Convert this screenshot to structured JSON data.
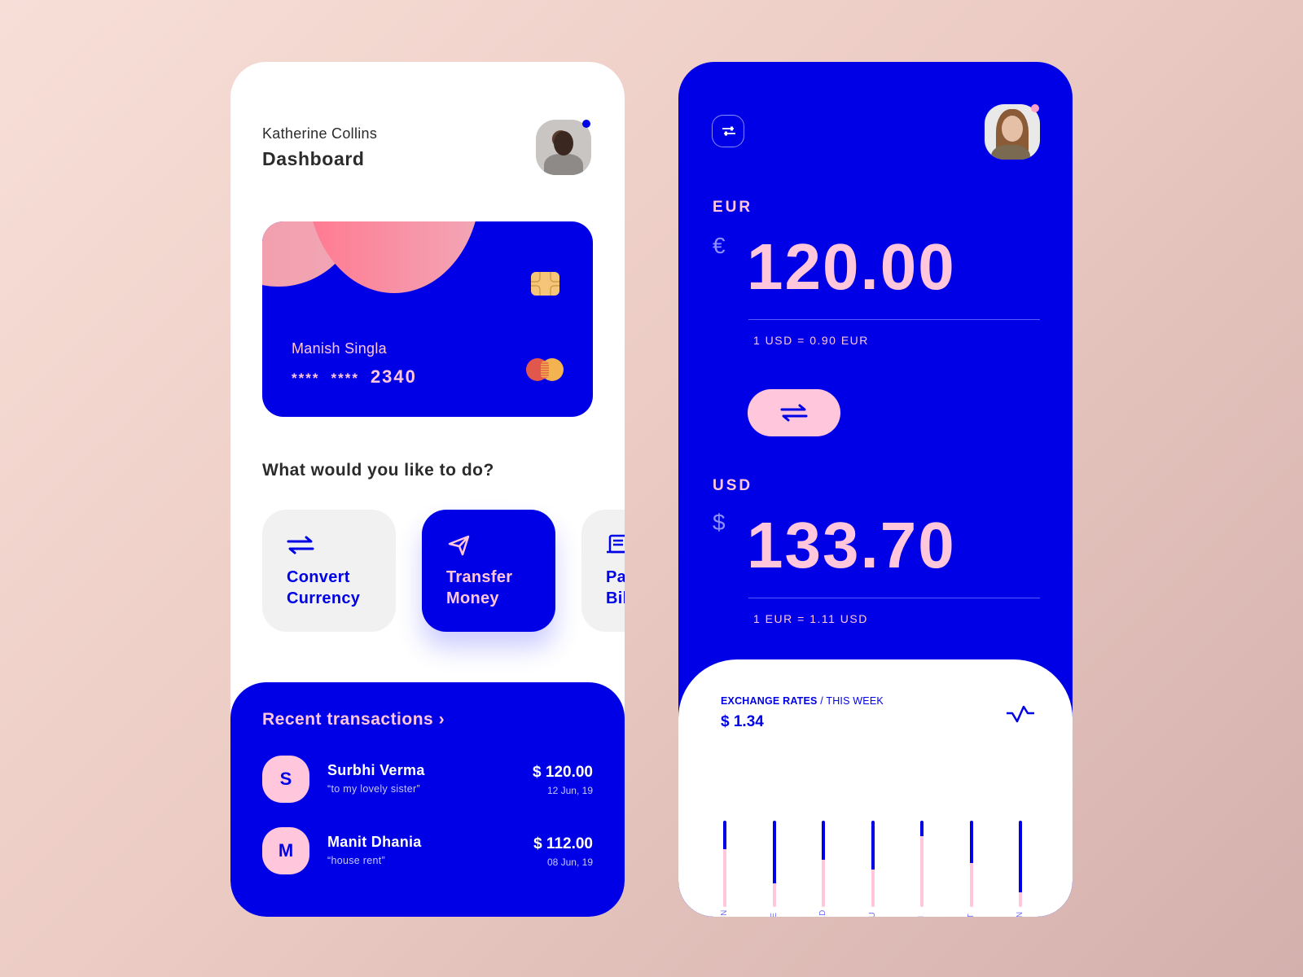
{
  "colors": {
    "brand_blue": "#0000e6",
    "accent_pink": "#ffc6dc",
    "card_circle_pink": "#ff7a91",
    "chip_gold": "#f5c67a",
    "mastercard_red": "#e2574c",
    "mastercard_yellow": "#f3b350",
    "text_dark": "#2b2b2b",
    "action_bg": "#f1f1f1"
  },
  "dashboard": {
    "user_name": "Katherine Collins",
    "title": "Dashboard",
    "avatar_icon": "user-avatar",
    "card": {
      "holder": "Manish Singla",
      "mask_1": "****",
      "mask_2": "****",
      "last4": "2340",
      "chip_icon": "chip-icon",
      "network_icon": "mastercard-logo"
    },
    "question": "What would you like to do?",
    "actions": [
      {
        "icon": "swap-arrows-icon",
        "line1": "Convert",
        "line2": "Currency"
      },
      {
        "icon": "send-icon",
        "line1": "Transfer",
        "line2": "Money"
      },
      {
        "icon": "receipt-icon",
        "line1": "Pay",
        "line2": "Bills"
      }
    ],
    "transactions": {
      "title": "Recent transactions",
      "chevron": "›",
      "items": [
        {
          "initial": "S",
          "name": "Surbhi Verma",
          "note": "“to my lovely sister”",
          "amount": "$ 120.00",
          "date": "12 Jun, 19"
        },
        {
          "initial": "M",
          "name": "Manit Dhania",
          "note": "“house rent”",
          "amount": "$ 112.00",
          "date": "08 Jun, 19"
        }
      ]
    }
  },
  "converter": {
    "filter_icon": "sliders-icon",
    "avatar_icon": "user-avatar",
    "from": {
      "code": "EUR",
      "symbol": "€",
      "amount": "120.00",
      "rate": "1 USD = 0.90 EUR"
    },
    "swap_icon": "swap-arrows-icon",
    "to": {
      "code": "USD",
      "symbol": "$",
      "amount": "133.70",
      "rate": "1 EUR = 1.11 USD"
    },
    "rates": {
      "title_bold": "EXCHANGE RATES",
      "title_rest": " / THIS WEEK",
      "value": "$ 1.34",
      "pulse_icon": "activity-icon"
    }
  },
  "chart_data": {
    "type": "bar",
    "title": "EXCHANGE RATES / THIS WEEK",
    "categories": [
      "MON",
      "TUE",
      "WED",
      "THU",
      "FRI",
      "SAT",
      "SUN"
    ],
    "series": [
      {
        "name": "filled (pink)",
        "values": [
          0.67,
          0.27,
          0.55,
          0.43,
          0.82,
          0.51,
          0.17
        ]
      }
    ],
    "ylim": [
      0,
      1
    ],
    "grid": false,
    "legend": "none"
  }
}
